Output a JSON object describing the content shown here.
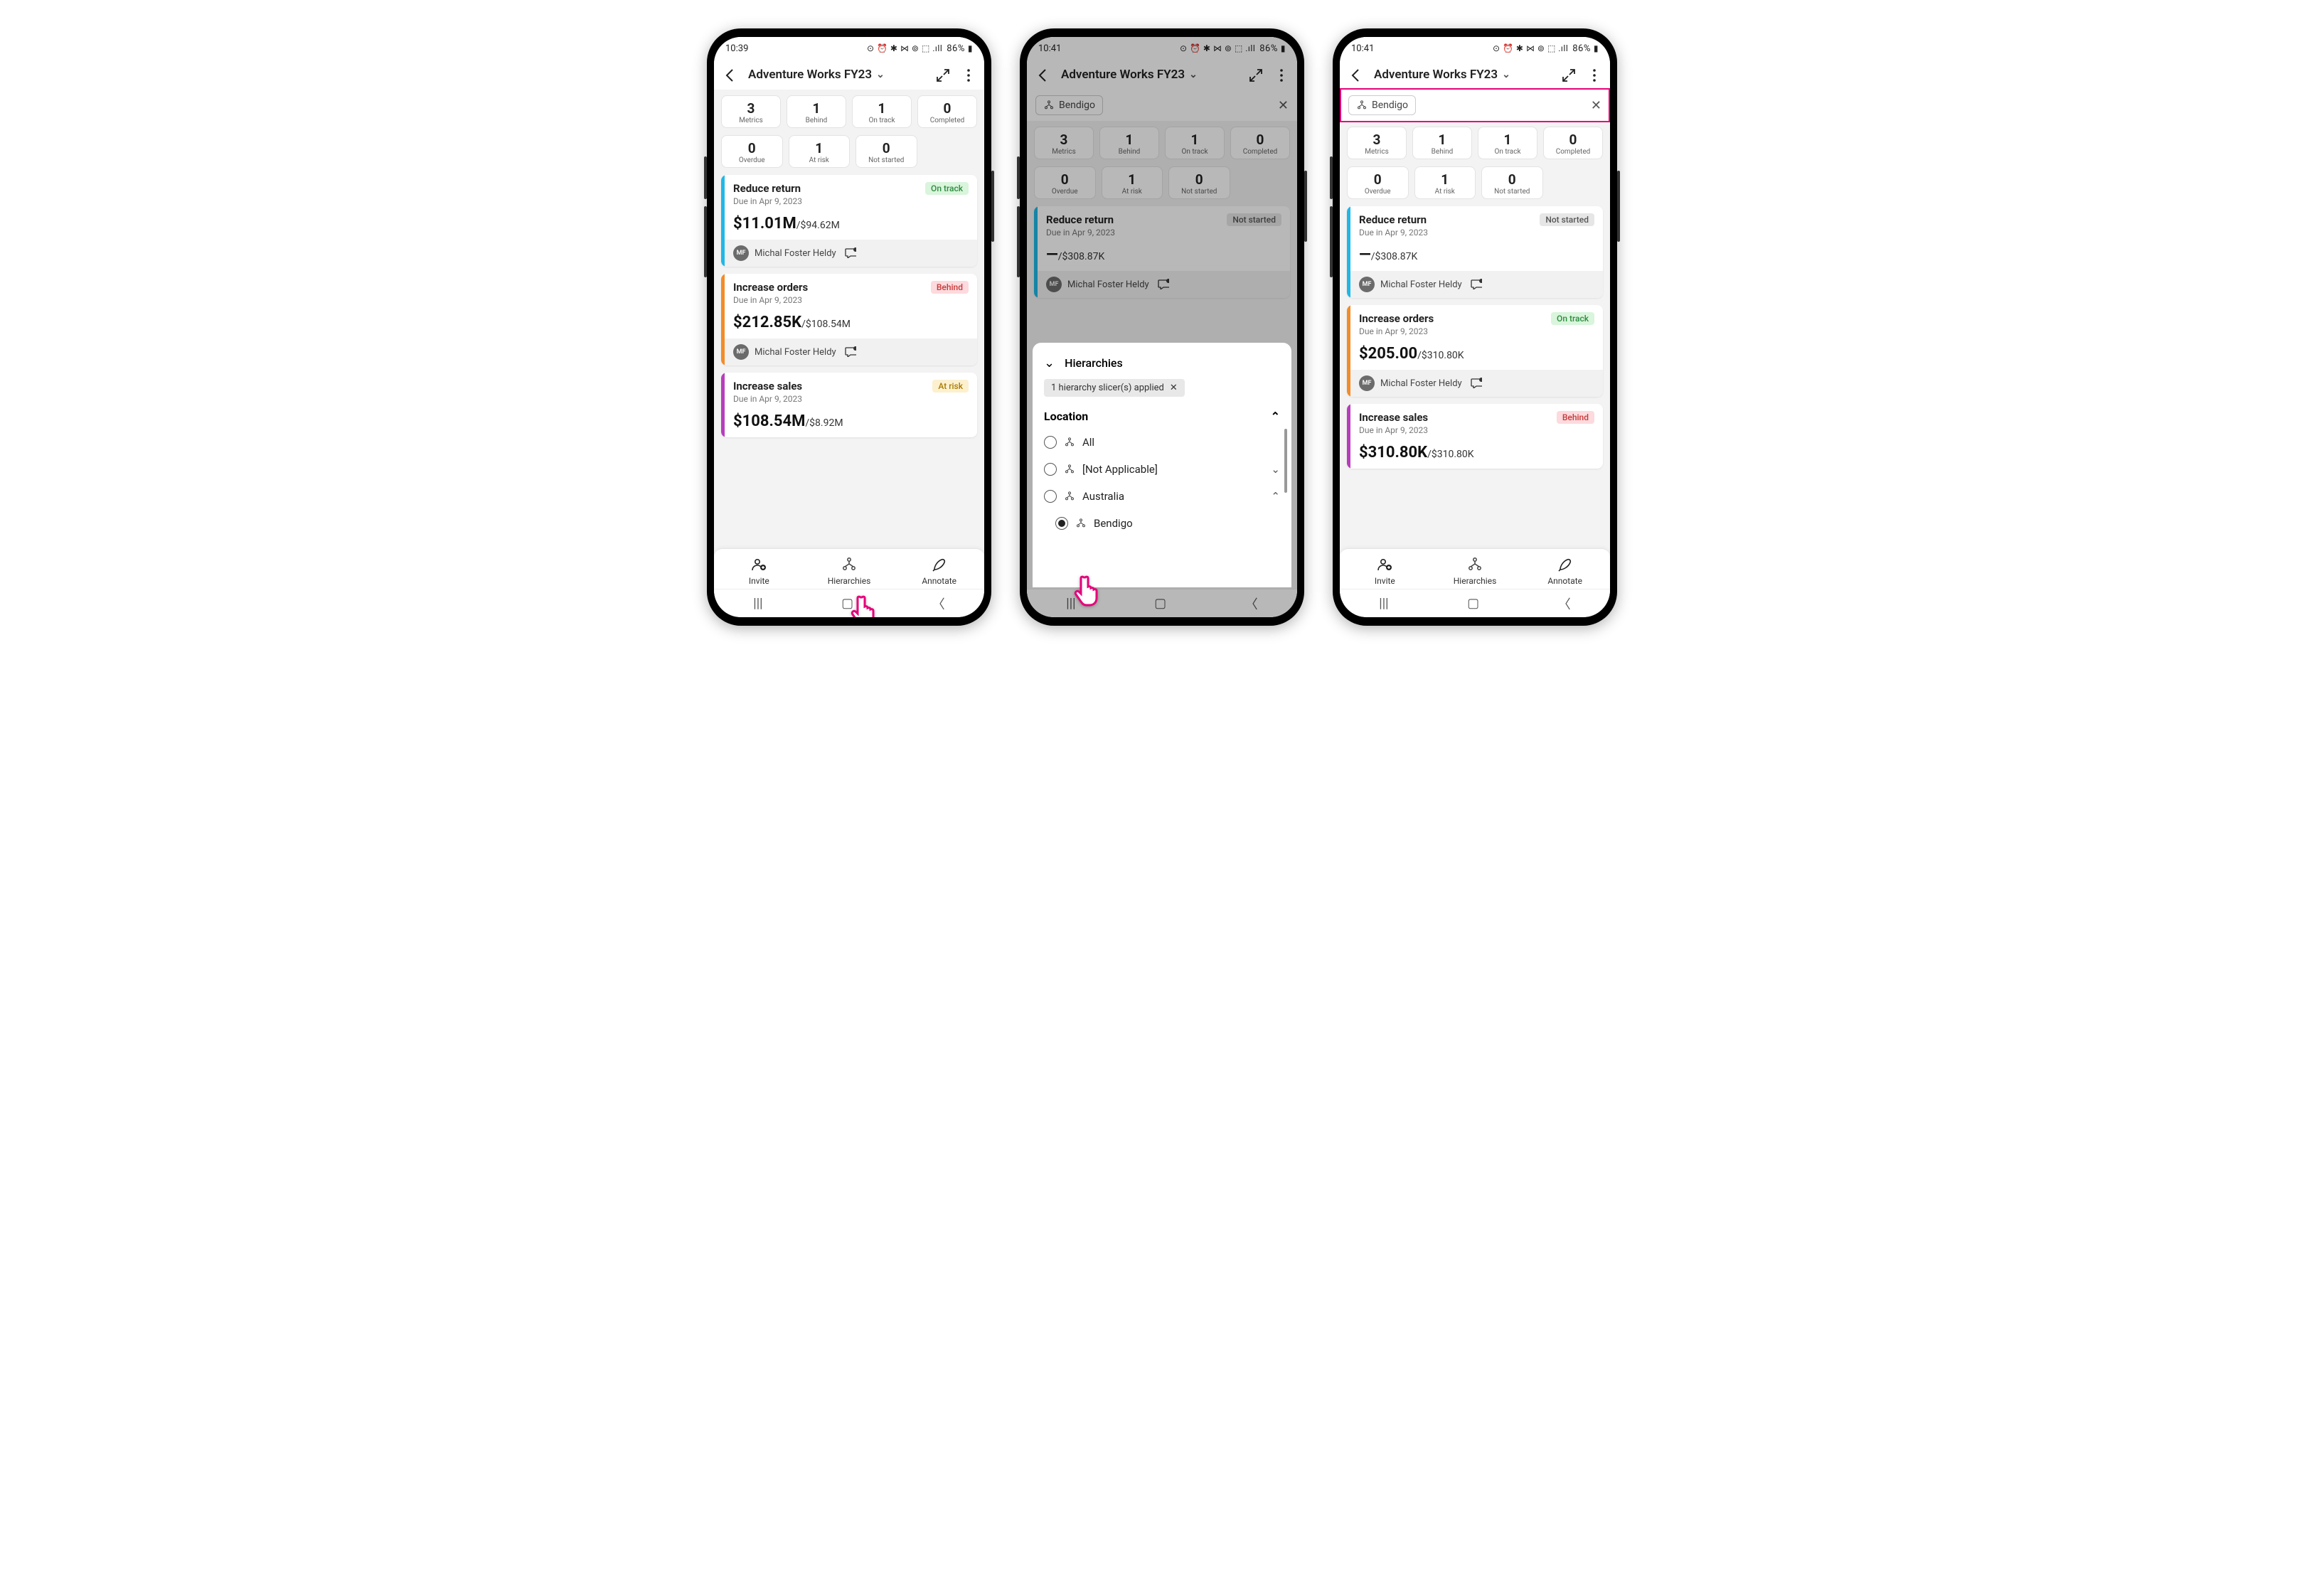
{
  "phones": {
    "p1": {
      "status": {
        "time": "10:39",
        "icons": "⊙ ⏰ ✱ ⋈ ⊚ ⬚ .ıll",
        "battery": "86%"
      },
      "header": {
        "title": "Adventure Works FY23"
      },
      "stats_row1": [
        {
          "val": "3",
          "label": "Metrics"
        },
        {
          "val": "1",
          "label": "Behind"
        },
        {
          "val": "1",
          "label": "On track"
        },
        {
          "val": "0",
          "label": "Completed"
        }
      ],
      "stats_row2": [
        {
          "val": "0",
          "label": "Overdue"
        },
        {
          "val": "1",
          "label": "At risk"
        },
        {
          "val": "0",
          "label": "Not started"
        }
      ],
      "cards": [
        {
          "bar": "#1fb8e6",
          "title": "Reduce return",
          "due": "Due in Apr 9, 2023",
          "badge": "On track",
          "badge_class": "badge-ontrack",
          "big": "$11.01M",
          "target": "/$94.62M",
          "owner": "Michal Foster Heldy",
          "initials": "MF"
        },
        {
          "bar": "#f28c28",
          "title": "Increase orders",
          "due": "Due in Apr 9, 2023",
          "badge": "Behind",
          "badge_class": "badge-behind",
          "big": "$212.85K",
          "target": "/$108.54M",
          "owner": "Michal Foster Heldy",
          "initials": "MF"
        },
        {
          "bar": "#b83dbb",
          "title": "Increase sales",
          "due": "Due in Apr 9, 2023",
          "badge": "At risk",
          "badge_class": "badge-atrisk",
          "big": "$108.54M",
          "target": "/$8.92M",
          "owner": "",
          "initials": ""
        }
      ],
      "bottom": {
        "invite": "Invite",
        "hierarchies": "Hierarchies",
        "annotate": "Annotate"
      }
    },
    "p2": {
      "status": {
        "time": "10:41",
        "icons": "⊙ ⏰ ✱ ⋈ ⊚ ⬚ .ıll",
        "battery": "86%"
      },
      "header": {
        "title": "Adventure Works FY23"
      },
      "filter": {
        "chip": "Bendigo"
      },
      "stats_row1": [
        {
          "val": "3",
          "label": "Metrics"
        },
        {
          "val": "1",
          "label": "Behind"
        },
        {
          "val": "1",
          "label": "On track"
        },
        {
          "val": "0",
          "label": "Completed"
        }
      ],
      "stats_row2": [
        {
          "val": "0",
          "label": "Overdue"
        },
        {
          "val": "1",
          "label": "At risk"
        },
        {
          "val": "0",
          "label": "Not started"
        }
      ],
      "card": {
        "bar": "#1fb8e6",
        "title": "Reduce return",
        "due": "Due in Apr 9, 2023",
        "badge": "Not started",
        "badge_class": "badge-notstarted",
        "big": "—",
        "target": "/$308.87K",
        "owner": "Michal Foster Heldy",
        "initials": "MF"
      },
      "panel": {
        "title": "Hierarchies",
        "applied": "1 hierarchy slicer(s) applied",
        "section": "Location",
        "items": [
          {
            "label": "All",
            "child": false,
            "selected": false,
            "expand": ""
          },
          {
            "label": "[Not Applicable]",
            "child": false,
            "selected": false,
            "expand": "∨"
          },
          {
            "label": "Australia",
            "child": false,
            "selected": false,
            "expand": "∧"
          },
          {
            "label": "Bendigo",
            "child": true,
            "selected": true,
            "expand": ""
          }
        ]
      }
    },
    "p3": {
      "status": {
        "time": "10:41",
        "icons": "⊙ ⏰ ✱ ⋈ ⊚ ⬚ .ıll",
        "battery": "86%"
      },
      "header": {
        "title": "Adventure Works FY23"
      },
      "filter": {
        "chip": "Bendigo"
      },
      "stats_row1": [
        {
          "val": "3",
          "label": "Metrics"
        },
        {
          "val": "1",
          "label": "Behind"
        },
        {
          "val": "1",
          "label": "On track"
        },
        {
          "val": "0",
          "label": "Completed"
        }
      ],
      "stats_row2": [
        {
          "val": "0",
          "label": "Overdue"
        },
        {
          "val": "1",
          "label": "At risk"
        },
        {
          "val": "0",
          "label": "Not started"
        }
      ],
      "cards": [
        {
          "bar": "#1fb8e6",
          "title": "Reduce return",
          "due": "Due in Apr 9, 2023",
          "badge": "Not started",
          "badge_class": "badge-notstarted",
          "big": "—",
          "target": "/$308.87K",
          "owner": "Michal Foster Heldy",
          "initials": "MF"
        },
        {
          "bar": "#f28c28",
          "title": "Increase orders",
          "due": "Due in Apr 9, 2023",
          "badge": "On track",
          "badge_class": "badge-ontrack",
          "big": "$205.00",
          "target": "/$310.80K",
          "owner": "Michal Foster Heldy",
          "initials": "MF"
        },
        {
          "bar": "#b83dbb",
          "title": "Increase sales",
          "due": "Due in Apr 9, 2023",
          "badge": "Behind",
          "badge_class": "badge-behind",
          "big": "$310.80K",
          "target": "/$310.80K",
          "owner": "",
          "initials": ""
        }
      ],
      "bottom": {
        "invite": "Invite",
        "hierarchies": "Hierarchies",
        "annotate": "Annotate"
      }
    }
  }
}
